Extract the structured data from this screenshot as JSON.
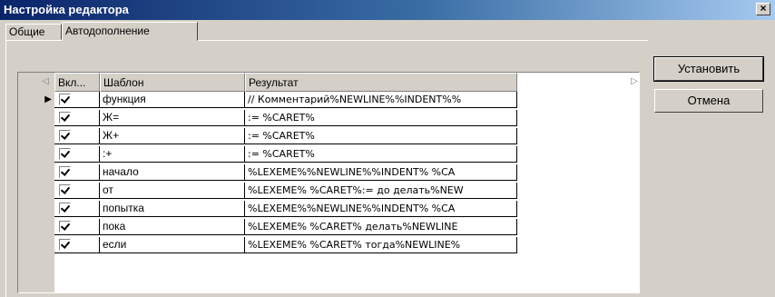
{
  "window": {
    "title": "Настройка редактора",
    "close_label": "×"
  },
  "tabs": [
    {
      "label": "Общие",
      "active": false
    },
    {
      "label": "Автодополнение",
      "active": true
    }
  ],
  "grid": {
    "headers": [
      "Вкл...",
      "Шаблон",
      "Результат"
    ],
    "scroll_left_icon": "◁",
    "scroll_right_icon": "▷",
    "current_row_icon": "▶",
    "rows": [
      {
        "enabled": true,
        "template": "функция",
        "result": "// Комментарий%NEWLINE%%INDENT%%"
      },
      {
        "enabled": true,
        "template": "Ж=",
        "result": ":= %CARET%"
      },
      {
        "enabled": true,
        "template": "Ж+",
        "result": ":= %CARET%"
      },
      {
        "enabled": true,
        "template": ":+",
        "result": ":= %CARET%"
      },
      {
        "enabled": true,
        "template": "начало",
        "result": "%LEXEME%%NEWLINE%%INDENT%  %CA"
      },
      {
        "enabled": true,
        "template": "от",
        "result": "%LEXEME% %CARET%:= до делать%NEW"
      },
      {
        "enabled": true,
        "template": "попытка",
        "result": "%LEXEME%%NEWLINE%%INDENT%  %CA"
      },
      {
        "enabled": true,
        "template": "пока",
        "result": "%LEXEME% %CARET% делать%NEWLINE"
      },
      {
        "enabled": true,
        "template": "если",
        "result": "%LEXEME% %CARET% тогда%NEWLINE%"
      }
    ]
  },
  "buttons": {
    "apply": "Установить",
    "cancel": "Отмена"
  }
}
